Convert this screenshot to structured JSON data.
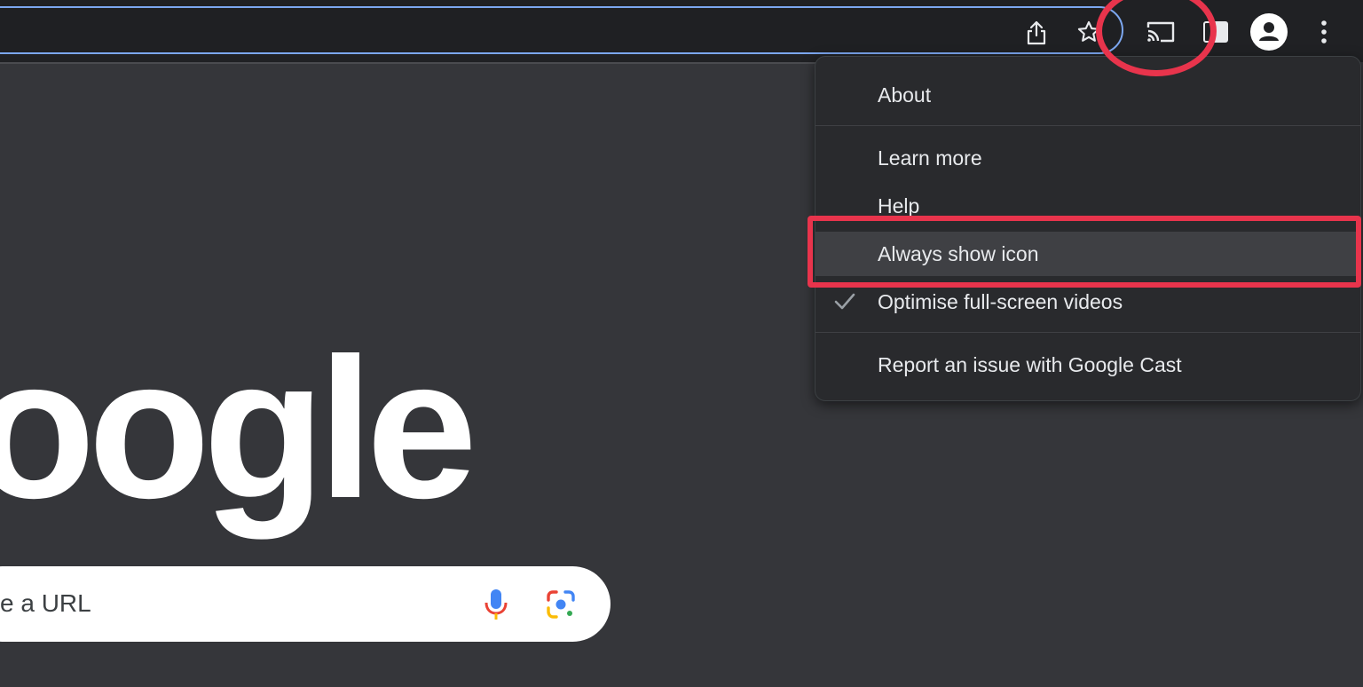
{
  "toolbar": {
    "icons": [
      "share-icon",
      "bookmark-star-icon",
      "cast-icon",
      "side-panel-icon",
      "profile-icon",
      "more-menu-icon"
    ]
  },
  "page": {
    "logo_text": "oogle",
    "search_placeholder": "e a URL"
  },
  "cast_menu": {
    "items": [
      {
        "label": "About"
      },
      {
        "label": "Learn more"
      },
      {
        "label": "Help"
      },
      {
        "label": "Always show icon",
        "highlighted": true
      },
      {
        "label": "Optimise full-screen videos",
        "checked": true
      },
      {
        "label": "Report an issue with Google Cast"
      }
    ]
  },
  "colors": {
    "annotation": "#e8344c",
    "page_background": "#35363a",
    "toolbar_background": "#202124",
    "omnibox_focus": "#7ca7f0"
  }
}
